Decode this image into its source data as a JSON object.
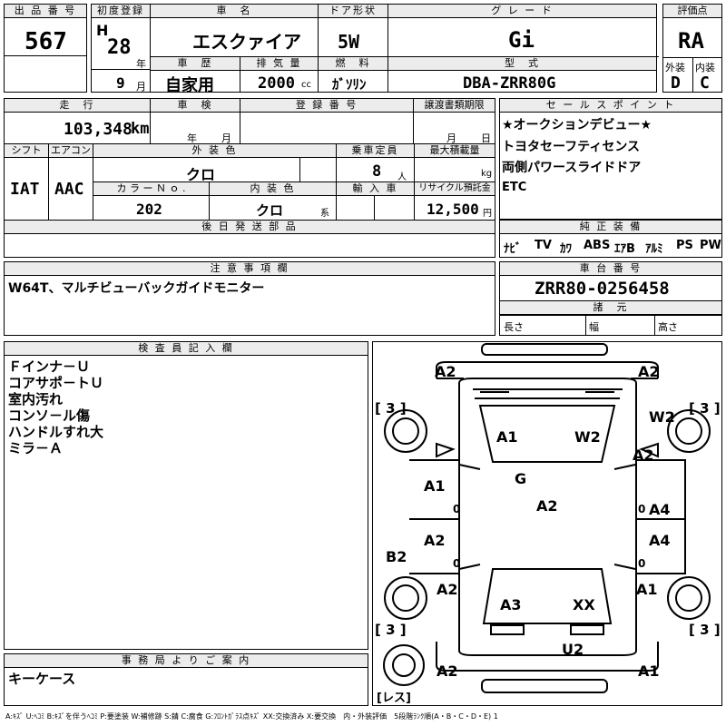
{
  "header": {
    "lot_label": "出 品 番 号",
    "lot_no": "567",
    "reg_label": "初度登録",
    "era": "H",
    "year": "28",
    "year_unit": "年",
    "month": "9",
    "month_unit": "月",
    "name_label": "車　名",
    "car_name": "エスクァイア",
    "history_label": "車　歴",
    "history": "自家用",
    "disp_label": "排 気 量",
    "disp": "2000",
    "disp_unit": "cc",
    "door_label": "ドア形状",
    "door": "5W",
    "fuel_label": "燃　料",
    "fuel": "ｶﾞｿﾘﾝ",
    "grade_label": "グ レ ー ド",
    "grade": "Gi",
    "model_label": "型　式",
    "model": "DBA-ZRR80G",
    "score_label": "評価点",
    "score": "RA",
    "ext_label": "外装",
    "ext": "D",
    "int_label": "内装",
    "int": "C"
  },
  "row2": {
    "mileage_label": "走　行",
    "mileage": "103,348",
    "mileage_unit": "km",
    "inspection_label": "車　検",
    "insp_year_unit": "年",
    "insp_month_unit": "月",
    "regno_label": "登 録 番 号",
    "transfer_label": "譲渡書類期限",
    "transfer_month_unit": "月",
    "transfer_day_unit": "日",
    "shift_label": "シフト",
    "shift": "IAT",
    "ac_label": "エアコン",
    "ac": "AAC",
    "color_label": "外 装 色",
    "color": "クロ",
    "seats_label": "乗車定員",
    "seats": "8",
    "seats_unit": "人",
    "load_label": "最大積載量",
    "load_unit": "kg",
    "colorno_label": "カ ラ ー Ｎ ｏ .",
    "colorno": "202",
    "intcolor_label": "内 装 色",
    "intcolor": "クロ",
    "intcolor_unit": "系",
    "import_label": "輸 入 車",
    "recycle_label": "リサイクル預託金",
    "recycle": "12,500",
    "recycle_unit": "円",
    "later_label": "後 日 発 送 部 品"
  },
  "sales": {
    "label": "セ ー ル ス ポ イ ン ト",
    "lines": [
      "★オークションデビュー★",
      "トヨタセーフティセンス",
      "両側パワースライドドア",
      "ETC"
    ]
  },
  "equip": {
    "label": "純 正 装 備",
    "items": [
      "ﾅﾋﾞ",
      "TV",
      "ｶﾜ",
      "ABS",
      "ｴｱB",
      "ｱﾙﾐ",
      "PS",
      "PW"
    ]
  },
  "notes": {
    "label": "注 意 事 項 欄",
    "text": "W64T、マルチビューバックガイドモニター"
  },
  "chassis": {
    "label": "車 台 番 号",
    "value": "ZRR80-0256458",
    "dims_label": "諸　元",
    "length": "長さ",
    "width": "幅",
    "height": "高さ"
  },
  "inspector": {
    "label": "検 査 員 記 入 欄",
    "lines": [
      "Ｆインナ－Ｕ",
      "コアサポ－トＵ",
      "室内汚れ",
      "コンソ－ル傷",
      "ハンドルすれ大",
      "ミラ－Ａ"
    ]
  },
  "office": {
    "label": "事 務 局 よ り ご 案 内",
    "text": "キーケース"
  },
  "diagram": {
    "marks": {
      "tl": "A2",
      "tr": "A2",
      "w2r": "W2",
      "a2r": "A2",
      "hood_a1": "A1",
      "hood_w2": "W2",
      "g": "G",
      "roof": "A2",
      "lf_a1": "A1",
      "lf_0": "0",
      "rf_0": "0",
      "rf_a4": "A4",
      "lr_a2": "A2",
      "lr_0": "0",
      "rr_0": "0",
      "rr_a4": "A4",
      "b2": "B2",
      "lq_a2": "A2",
      "rq_a1": "A1",
      "trunk_a3": "A3",
      "trunk_xx": "XX",
      "u2": "U2",
      "bl": "A2",
      "br": "A1"
    },
    "tyres": [
      "3",
      "3",
      "3",
      "3"
    ],
    "spare": "レス"
  },
  "legend": "A:ｷｽﾞ U:ﾍｺﾐ B:ｷｽﾞを伴うﾍｺﾐ P:要塗装 W:補修跡 S:錆 C:腐食 G:ﾌﾛﾝﾄｶﾞﾗｽ点ｷｽﾞ XX:交換済み X:要交換　内・外装評価　5段階ﾗﾝｸ順(A・B・C・D・E) 1"
}
